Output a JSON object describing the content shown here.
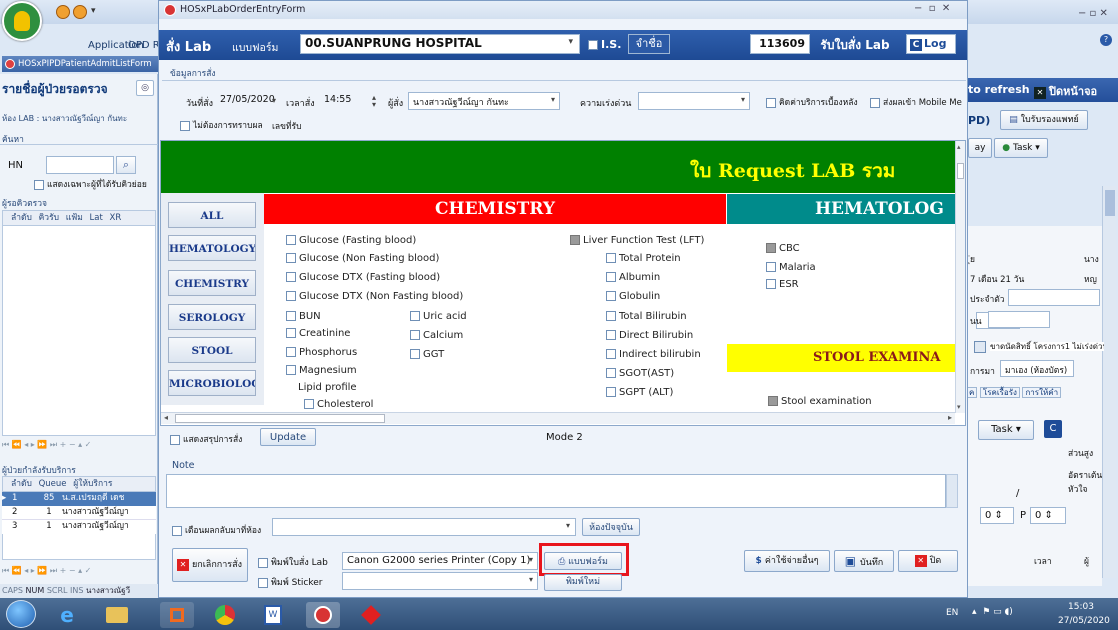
{
  "bg_window": {
    "menu_application": "Application",
    "menu_opd": "OPD R",
    "tab_admit": "HOSxPIPDPatientAdmitListForm",
    "left_title": "รายชื่อผู้ป่วยรอตรวจ",
    "room_label": "ห้อง LAB : นางสาวณัฐวีณ์ญา กันทะ",
    "search_label": "ค้นหา",
    "hn_label": "HN",
    "show_only_label": "แสดงเฉพาะผู้ที่ได้รับคิวย่อย",
    "waiting_label": "ผู้รอคิวตรวจ",
    "waiting_headers": [
      "ลำดับ",
      "คิวรับ",
      "แฟ้ม",
      "Lat",
      "XR"
    ],
    "serving_label": "ผู้ป่วยกำลังรับบริการ",
    "serving_headers": [
      "ลำดับ",
      "Queue",
      "ผู้ให้บริการ"
    ],
    "serving_rows": [
      {
        "seq": "1",
        "queue": "85",
        "provider": "น.ส.เปรมฤดี เดช"
      },
      {
        "seq": "2",
        "queue": "1",
        "provider": "นางสาวณัฐวีณ์ญา"
      },
      {
        "seq": "3",
        "queue": "1",
        "provider": "นางสาวณัฐวีณ์ญา"
      }
    ],
    "status_bar": [
      "CAPS",
      "NUM",
      "SCRL",
      "INS",
      "นางสาวณัฐวี"
    ],
    "right_refresh": "to refresh",
    "right_close": "ปิดหน้าจอ",
    "right_pd": "PD)",
    "right_doctor": "ใบรับรองแพทย์",
    "right_ay": "ay",
    "right_task": "Task",
    "right_fields": [
      "ุ่ย",
      "7 เดือน 21 วัน",
      "ประจำตัว",
      "นน",
      "การมา",
      "มาเอง (ห้องบัตร)",
      "ค",
      "โรคเรื้อรัง",
      "การให้คำ"
    ],
    "right_mid_text": "ขาดนัดสิทธิ์ โครงการ1 ไม่เร่งด่วน",
    "right_na": "นาง",
    "right_hu": "หญ",
    "right_task2": "Task",
    "right_part": "ส่วนสูง",
    "right_heart": "อัตราเต้นหัวใจ",
    "right_slash": "/",
    "right_p": "P",
    "right_zero": "0",
    "right_time": "เวลา",
    "right_pu": "ผู้"
  },
  "lab_window": {
    "title": "HOSxPLabOrderEntryForm",
    "order_label": "สั่ง Lab",
    "form_label": "แบบฟอร์ม",
    "form_value": "00.SUANPRUNG HOSPITAL",
    "is_label": "I.S.",
    "name_btn": "จำชื่อ",
    "order_no": "113609",
    "receive_btn": "รับใบสั่ง Lab",
    "log_btn": "Log",
    "section_info": "ข้อมูลการสั่ง",
    "date_label": "วันที่สั่ง",
    "date_value": "27/05/2020",
    "time_label": "เวลาสั่ง",
    "time_value": "14:55",
    "orderer_label": "ผู้สั่ง",
    "orderer_value": "นางสาวณัฐวีณ์ญา กันทะ",
    "urgency_label": "ความเร่งด่วน",
    "urgency_value": "",
    "charge_label": "คิดค่าบริการเบื้องหลัง",
    "mobile_label": "ส่งผลเข้า Mobile Me",
    "no_result_label": "ไม่ต้องการทราบผล",
    "receive_no_label": "เลขที่รับ",
    "banner_title": "ใบ Request LAB รวม",
    "nav": [
      "ALL",
      "HEMATOLOGY",
      "CHEMISTRY",
      "SEROLOGY",
      "STOOL",
      "MICROBIOLOGY"
    ],
    "chemistry_header": "CHEMISTRY",
    "hematology_header": "HEMATOLOG",
    "stool_header": "STOOL EXAMINA",
    "chem_col1": [
      "Glucose (Fasting blood)",
      "Glucose (Non Fasting blood)",
      "Glucose DTX (Fasting blood)",
      "Glucose DTX (Non Fasting blood)",
      "BUN",
      "Creatinine",
      "Phosphorus",
      "Magnesium"
    ],
    "chem_col2": [
      "Uric acid",
      "Calcium",
      "GGT"
    ],
    "lipid_label": "Lipid profile",
    "cholesterol": "Cholesterol",
    "lft_label": "Liver Function Test (LFT)",
    "lft_items": [
      "Total Protein",
      "Albumin",
      "Globulin",
      "Total Bilirubin",
      "Direct Bilirubin",
      "Indirect bilirubin",
      "SGOT(AST)",
      "SGPT (ALT)"
    ],
    "hema_items": [
      "CBC",
      "Malaria",
      "ESR"
    ],
    "stool_item": "Stool examination",
    "summary_label": "แสดงสรุปการสั่ง",
    "update_btn": "Update",
    "mode_label": "Mode 2",
    "note_label": "Note",
    "note_value": "",
    "remind_label": "เตือนผลกลับมาที่ห้อง",
    "room_btn": "ห้องปัจจุบัน",
    "cancel_btn": "ยกเลิกการสั่ง",
    "print_lab_label": "พิมพ์ใบสั่ง Lab",
    "printer_value": "Canon G2000 series Printer (Copy 1)",
    "form_btn": "แบบฟอร์ม",
    "print_sticker_label": "พิมพ์ Sticker",
    "reprint_btn": "พิมพ์ใหม่",
    "other_cost_btn": "ค่าใช้จ่ายอื่นๆ",
    "save_btn": "บันทึก",
    "close_btn": "ปิด"
  },
  "taskbar": {
    "lang": "EN",
    "time": "15:03",
    "date": "27/05/2020"
  },
  "colors": {
    "chem_header_bg": "#ff0000",
    "chem_header_fg": "#ffffff",
    "hema_header_bg": "#008b8b",
    "stool_header_bg": "#ffff00",
    "banner_bg": "#008000",
    "banner_fg": "#ffff00",
    "highlight_box": "#e8141c"
  }
}
